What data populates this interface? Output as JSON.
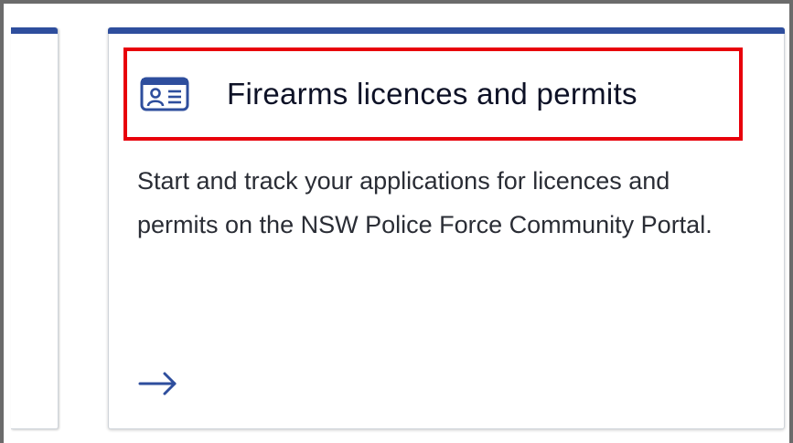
{
  "cards": [
    {
      "title": "Firearms licences and permits",
      "description": "Start and track your applications for licences and permits on the NSW Police Force Community Portal.",
      "icon": "id-card-icon",
      "link_icon": "arrow-right-icon"
    }
  ],
  "colors": {
    "accent": "#2e4e9d",
    "highlight": "#e8000b",
    "title": "#0d1126",
    "text": "#2a2d35"
  }
}
